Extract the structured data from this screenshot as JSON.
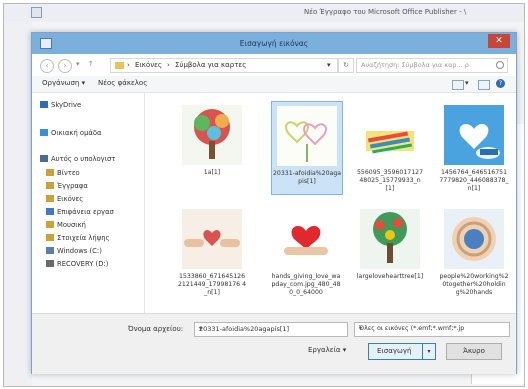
{
  "outer_window": {
    "title": "Νέο Έγγραφο του Microsoft Office Publisher - \\"
  },
  "dialog": {
    "title": "Εισαγωγή εικόνας",
    "close_glyph": "✕"
  },
  "nav": {
    "breadcrumb": [
      "Εικόνες",
      "Σύμβολα για καρτες"
    ],
    "search_placeholder": "Αναζήτηση: Σύμβολα για καρ... ρ"
  },
  "toolbar": {
    "organize": "Οργάνωση ▾",
    "new_folder": "Νέος φάκελος",
    "view_icon": "view-mode-icon",
    "help_glyph": "?"
  },
  "sidebar": {
    "items": [
      {
        "label": "SkyDrive",
        "icon": "cloud-icon",
        "color": "#2f6db2",
        "sub": false
      },
      {
        "label": "Οικιακή ομάδα",
        "icon": "homegroup-icon",
        "color": "#3a8fd0",
        "sub": false
      },
      {
        "label": "Αυτός ο υπολογιστ",
        "icon": "computer-icon",
        "color": "#4a6b93",
        "sub": false
      },
      {
        "label": "Βίντεο",
        "icon": "video-folder-icon",
        "color": "#c9a23b",
        "sub": true
      },
      {
        "label": "Έγγραφα",
        "icon": "documents-folder-icon",
        "color": "#c9a23b",
        "sub": true
      },
      {
        "label": "Εικόνες",
        "icon": "pictures-folder-icon",
        "color": "#c9a23b",
        "sub": true
      },
      {
        "label": "Επιφάνεια εργασ",
        "icon": "desktop-folder-icon",
        "color": "#3e7bc4",
        "sub": true
      },
      {
        "label": "Μουσική",
        "icon": "music-folder-icon",
        "color": "#c9a23b",
        "sub": true
      },
      {
        "label": "Στοιχεία λήψης",
        "icon": "downloads-folder-icon",
        "color": "#c9a23b",
        "sub": true
      },
      {
        "label": "Windows (C:)",
        "icon": "drive-icon",
        "color": "#5a7fa8",
        "sub": true
      },
      {
        "label": "RECOVERY (D:)",
        "icon": "drive-icon",
        "color": "#6a6a6a",
        "sub": true
      }
    ]
  },
  "files": [
    {
      "name": "1a[1]",
      "selected": false,
      "art": "tree"
    },
    {
      "name": "20331-afoidia%20agapis[1]",
      "selected": true,
      "art": "hearts"
    },
    {
      "name": "556095_359601712748025_15779933_n[1]",
      "selected": false,
      "art": "pencils"
    },
    {
      "name": "1456764_6465167517779820_446088378_n[1]",
      "selected": false,
      "art": "cloud-heart"
    },
    {
      "name": "1533860_6716451262121449_17998176 4_n[1]",
      "selected": false,
      "art": "hands-heart"
    },
    {
      "name": "hands_giving_love_wapday_com.jpg_480_480_0_64000",
      "selected": false,
      "art": "red-heart"
    },
    {
      "name": "largelovehearttree[1]",
      "selected": false,
      "art": "tree2"
    },
    {
      "name": "people%20working%20together%20holding%20hands",
      "selected": false,
      "art": "circle-hands"
    }
  ],
  "footer": {
    "filename_label": "Όνομα αρχείου:",
    "filename_value": "20331-afoidia%20agapis[1]",
    "filetype_value": "Όλες οι εικόνες (*.emf;*.wmf;*.jp",
    "tools": "Εργαλεία ▾",
    "insert": "Εισαγωγή",
    "insert_dd": "▾",
    "cancel": "Άκυρο"
  }
}
